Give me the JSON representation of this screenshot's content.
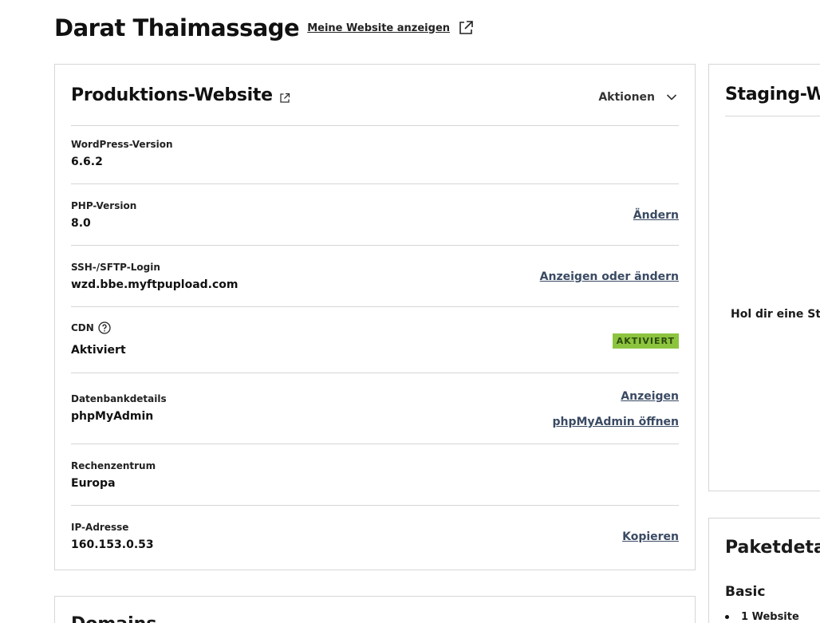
{
  "header": {
    "site_title": "Darat Thaimassage",
    "view_site_label": "Meine Website anzeigen",
    "view_site_icon": "external-link-icon"
  },
  "production": {
    "title": "Produktions-Website",
    "title_icon": "external-link-icon",
    "actions_label": "Aktionen",
    "rows": [
      {
        "label": "WordPress-Version",
        "value": "6.6.2"
      },
      {
        "label": "PHP-Version",
        "value": "8.0",
        "action": "Ändern"
      },
      {
        "label": "SSH-/SFTP-Login",
        "value": "wzd.bbe.myftpupload.com",
        "action": "Anzeigen oder ändern"
      },
      {
        "label": "CDN",
        "value": "Aktiviert",
        "badge": "AKTIVIERT",
        "help_icon": "question-circle-icon"
      },
      {
        "label": "Datenbankdetails",
        "value": "phpMyAdmin",
        "action": "Anzeigen",
        "action2": "phpMyAdmin öffnen"
      },
      {
        "label": "Rechenzentrum",
        "value": "Europa"
      },
      {
        "label": "IP-Adresse",
        "value": "160.153.0.53",
        "action": "Kopieren"
      }
    ]
  },
  "staging": {
    "title": "Staging-We",
    "text": "Hol dir eine Sta"
  },
  "package": {
    "title": "Paketdetail",
    "plan": "Basic",
    "items": [
      "1 Website"
    ]
  },
  "domains": {
    "title": "Domains"
  },
  "colors": {
    "badge_bg": "#8dc43f",
    "link": "#3a4a63",
    "border": "#d6d6d6"
  }
}
